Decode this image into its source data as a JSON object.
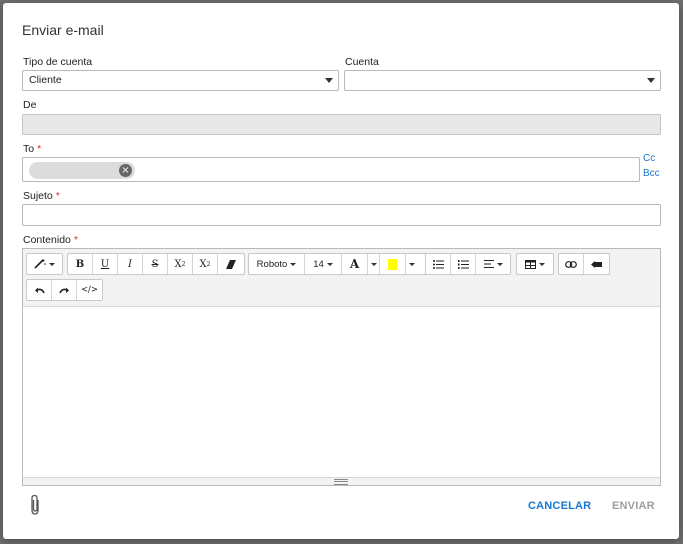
{
  "dialog": {
    "title": "Enviar e-mail"
  },
  "fields": {
    "account_type": {
      "label": "Tipo de cuenta",
      "value": "Cliente"
    },
    "account": {
      "label": "Cuenta",
      "value": ""
    },
    "from": {
      "label": "De",
      "value": ""
    },
    "to": {
      "label": "To",
      "required_mark": "*",
      "cc": "Cc",
      "bcc": "Bcc"
    },
    "subject": {
      "label": "Sujeto",
      "required_mark": "*",
      "value": ""
    },
    "content": {
      "label": "Contenido",
      "required_mark": "*"
    }
  },
  "toolbar": {
    "font_name": "Roboto",
    "font_size": "14",
    "highlight_color": "#ffff00",
    "code_view": "</>"
  },
  "actions": {
    "cancel": "CANCELAR",
    "send": "ENVIAR"
  },
  "colors": {
    "accent": "#1976d2",
    "required": "#d32f2f"
  }
}
